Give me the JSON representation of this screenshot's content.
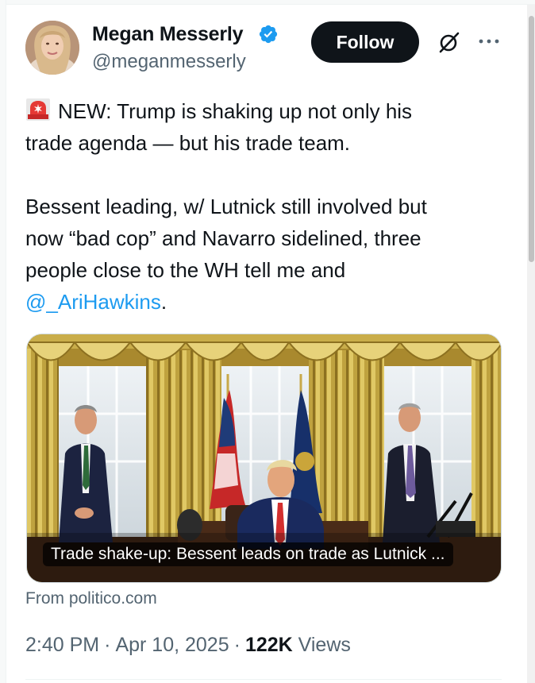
{
  "author": {
    "name": "Megan Messerly",
    "handle": "@meganmesserly",
    "verified": true,
    "verified_color": "#1d9bf0"
  },
  "actions": {
    "follow_label": "Follow",
    "grok_icon": "grok-icon",
    "more_icon": "more-options-icon"
  },
  "tweet": {
    "emoji": "rotating-light-icon",
    "line1": "NEW: Trump is shaking up not only his",
    "line2": "trade agenda — but his trade team.",
    "line3": "Bessent leading, w/ Lutnick still involved but",
    "line4": "now “bad cop” and Navarro sidelined, three",
    "line5": "people close to the WH tell me and",
    "mention": "@_AriHawkins",
    "trailing": "."
  },
  "card": {
    "caption": "Trade shake-up: Bessent leads on trade as Lutnick ...",
    "source": "From politico.com"
  },
  "meta": {
    "time": "2:40 PM",
    "date": "Apr 10, 2025",
    "views_count": "122K",
    "views_label": "Views"
  },
  "colors": {
    "text": "#0f1419",
    "secondary": "#536471",
    "link": "#1d9bf0",
    "button": "#0f1419"
  }
}
